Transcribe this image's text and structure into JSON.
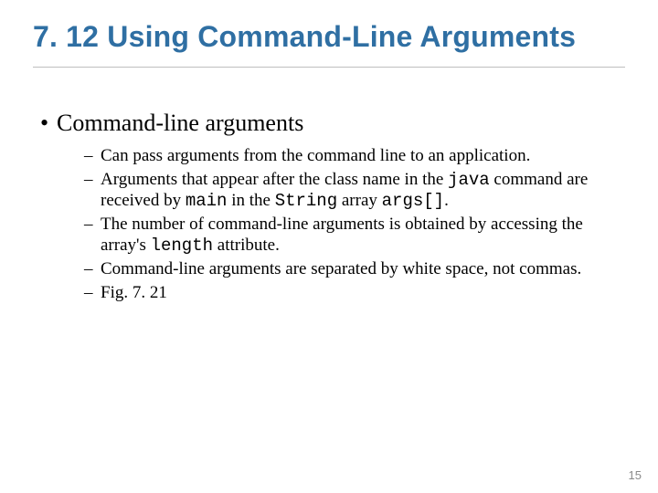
{
  "title": "7. 12  Using Command-Line Arguments",
  "bullet_main": "Command-line arguments",
  "subs": {
    "s1": "Can pass arguments from the command line to an application.",
    "s2a": "Arguments that appear after the class name in the ",
    "s2_code1": "java",
    "s2b": " command are received by ",
    "s2_code2": "main",
    "s2c": " in the ",
    "s2_code3": "String",
    "s2d": " array ",
    "s2_code4": "args[]",
    "s2e": ".",
    "s3a": "The number of command-line arguments is obtained by accessing the array's ",
    "s3_code1": "length",
    "s3b": " attribute.",
    "s4": "Command-line arguments are separated by white space, not commas.",
    "s5": "Fig. 7. 21"
  },
  "page_number": "15"
}
